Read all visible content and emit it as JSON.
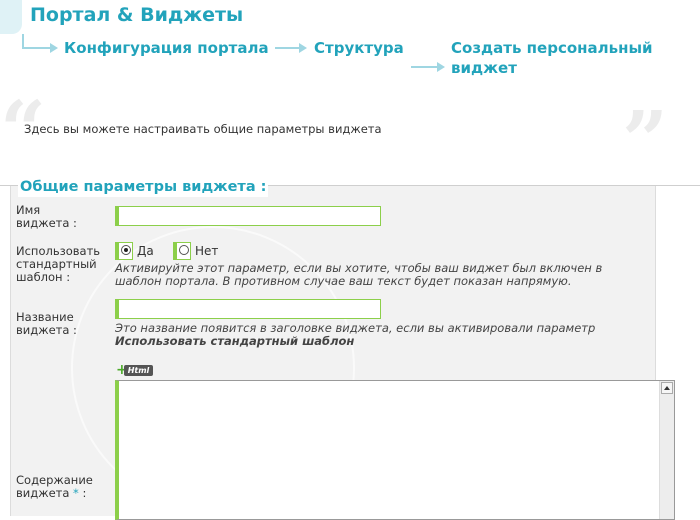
{
  "header": {
    "title": "Портал & Виджеты",
    "breadcrumb": [
      "Конфигурация портала",
      "Структура",
      "Создать персональный виджет"
    ],
    "quote_open": "“",
    "quote_close": "”"
  },
  "intro_text": "Здесь вы можете настраивать общие параметры виджета",
  "form": {
    "section_title": "Общие параметры виджета :",
    "widget_name": {
      "label": "Имя виджета :",
      "value": ""
    },
    "use_template": {
      "label": "Использовать стандартный шаблон :",
      "options": [
        "Да",
        "Нет"
      ],
      "selected": "Да",
      "hint": "Активируйте этот параметр, если вы хотите, чтобы ваш виджет был включен в шаблон портала. В противном случае ваш текст будет показан напрямую."
    },
    "widget_title": {
      "label": "Название виджета :",
      "value": "",
      "hint_prefix": "Это название появится в заголовке виджета, если вы активировали параметр",
      "hint_bold": "Использовать стандартный шаблон"
    },
    "html_button": {
      "plus": "+",
      "label": "Html"
    },
    "content": {
      "label": "Содержание виджета",
      "required_mark": "*",
      "suffix": ":",
      "value": ""
    }
  },
  "colors": {
    "accent": "#22a3bb",
    "field_border": "#8ccf4a",
    "panel_bg": "#f2f2f2"
  }
}
